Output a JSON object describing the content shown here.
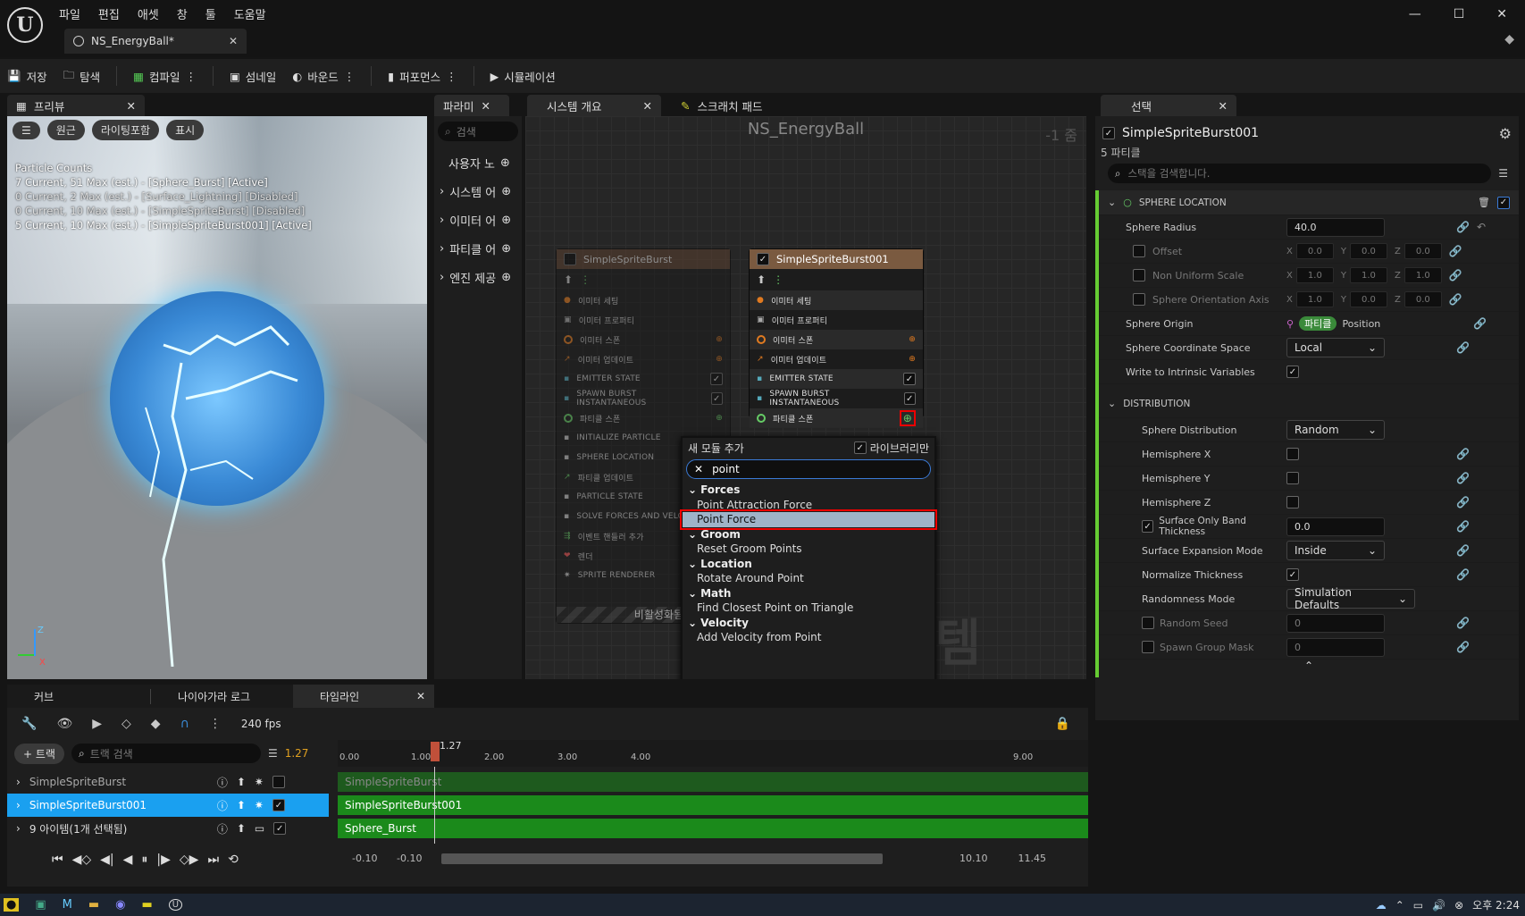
{
  "menu": [
    "파일",
    "편집",
    "애셋",
    "창",
    "툴",
    "도움말"
  ],
  "doc_tab": "NS_EnergyBall*",
  "toolbar": {
    "save": "저장",
    "browse": "탐색",
    "compile": "컴파일",
    "thumbnail": "섬네일",
    "bounds": "바운드",
    "performance": "퍼포먼스",
    "simulation": "시뮬레이션"
  },
  "preview": {
    "tab": "프리뷰",
    "btn_perspective": "원근",
    "btn_lighting": "라이팅포함",
    "btn_show": "표시",
    "stats_title": "Particle Counts",
    "stats": [
      "7 Current, 51 Max (est.) - [Sphere_Burst] [Active]",
      "0 Current, 2 Max (est.) - [Surface_Lightning] [Disabled]",
      "0 Current, 10 Max (est.) - [SimpleSpriteBurst] [Disabled]",
      "5 Current, 10 Max (est.) - [SimpleSpriteBurst001] [Active]"
    ],
    "axis_z": "Z",
    "axis_x": "X"
  },
  "params": {
    "tab": "파라미",
    "search_placeholder": "검색",
    "items": [
      "사용자 노",
      "시스템 어",
      "이미터 어",
      "파티클 어",
      "엔진 제공"
    ]
  },
  "graph": {
    "tab_overview": "시스템 개요",
    "tab_scratch": "스크래치 패드",
    "title": "NS_EnergyBall",
    "zoom": "-1 줌",
    "watermark": "시스템",
    "disabled_label": "비활성화됨",
    "node1": {
      "title": "SimpleSpriteBurst",
      "rows": [
        "이미터 세팅",
        "이미터 프로퍼티",
        "이미터 스폰",
        "이미터 업데이트",
        "EMITTER STATE",
        "SPAWN BURST INSTANTANEOUS",
        "파티클 스폰",
        "INITIALIZE PARTICLE",
        "SPHERE LOCATION",
        "파티클 업데이트",
        "PARTICLE STATE",
        "SOLVE FORCES AND VELOC",
        "이벤트 핸들러 추가",
        "렌더",
        "SPRITE RENDERER"
      ]
    },
    "node2": {
      "title": "SimpleSpriteBurst001",
      "rows": [
        "이미터 세팅",
        "이미터 프로퍼티",
        "이미터 스폰",
        "이미터 업데이트",
        "EMITTER STATE",
        "SPAWN BURST INSTANTANEOUS",
        "파티클 스폰"
      ]
    }
  },
  "add_module": {
    "title": "새 모듈 추가",
    "library_only": "라이브러리만",
    "search_value": "point",
    "sections": [
      {
        "category": "Forces",
        "items": [
          "Point Attraction Force",
          "Point Force"
        ]
      },
      {
        "category": "Groom",
        "items": [
          "Reset Groom Points"
        ]
      },
      {
        "category": "Location",
        "items": [
          "Rotate Around Point"
        ]
      },
      {
        "category": "Math",
        "items": [
          "Find Closest Point on Triangle"
        ]
      },
      {
        "category": "Velocity",
        "items": [
          "Add Velocity from Point"
        ]
      }
    ]
  },
  "selection": {
    "tab": "선택",
    "emitter_name": "SimpleSpriteBurst001",
    "subtitle": "5 파티클",
    "search_placeholder": "스택을 검색합니다.",
    "section1": "SPHERE LOCATION",
    "props1": [
      {
        "label": "Sphere Radius",
        "value": "40.0"
      },
      {
        "label": "Offset",
        "x": "0.0",
        "y": "0.0",
        "z": "0.0"
      },
      {
        "label": "Non Uniform Scale",
        "x": "1.0",
        "y": "1.0",
        "z": "1.0"
      },
      {
        "label": "Sphere Orientation Axis",
        "x": "1.0",
        "y": "0.0",
        "z": "0.0"
      },
      {
        "label": "Sphere Origin",
        "badge": "파티클",
        "value": "Position"
      },
      {
        "label": "Sphere Coordinate Space",
        "value": "Local"
      },
      {
        "label": "Write to Intrinsic Variables"
      }
    ],
    "section2": "DISTRIBUTION",
    "props2": [
      {
        "label": "Sphere Distribution",
        "value": "Random"
      },
      {
        "label": "Hemisphere X"
      },
      {
        "label": "Hemisphere Y"
      },
      {
        "label": "Hemisphere Z"
      },
      {
        "label": "Surface Only Band Thickness",
        "value": "0.0"
      },
      {
        "label": "Surface Expansion Mode",
        "value": "Inside"
      },
      {
        "label": "Normalize Thickness"
      },
      {
        "label": "Randomness Mode",
        "value": "Simulation Defaults"
      },
      {
        "label": "Random Seed",
        "value": "0"
      },
      {
        "label": "Spawn Group Mask",
        "value": "0"
      }
    ]
  },
  "bottom": {
    "tab_curves": "커브",
    "tab_log": "나이아가라 로그",
    "tab_timeline": "타임라인",
    "fps": "240 fps",
    "add_track": "+ 트랙",
    "track_search": "트랙 검색",
    "time_value": "1.27",
    "playhead": "1.27",
    "tracks": [
      "SimpleSpriteBurst",
      "SimpleSpriteBurst001",
      "Sphere_Burst"
    ],
    "items_count": "9 아이템(1개 선택됨)",
    "ticks": [
      "0.00",
      "1.00",
      "2.00",
      "3.00",
      "4.00",
      "9.00"
    ],
    "range_start": "-0.10",
    "range_start2": "-0.10",
    "range_end": "10.10",
    "range_end2": "11.45"
  },
  "taskbar": {
    "clock": "오후 2:24"
  }
}
